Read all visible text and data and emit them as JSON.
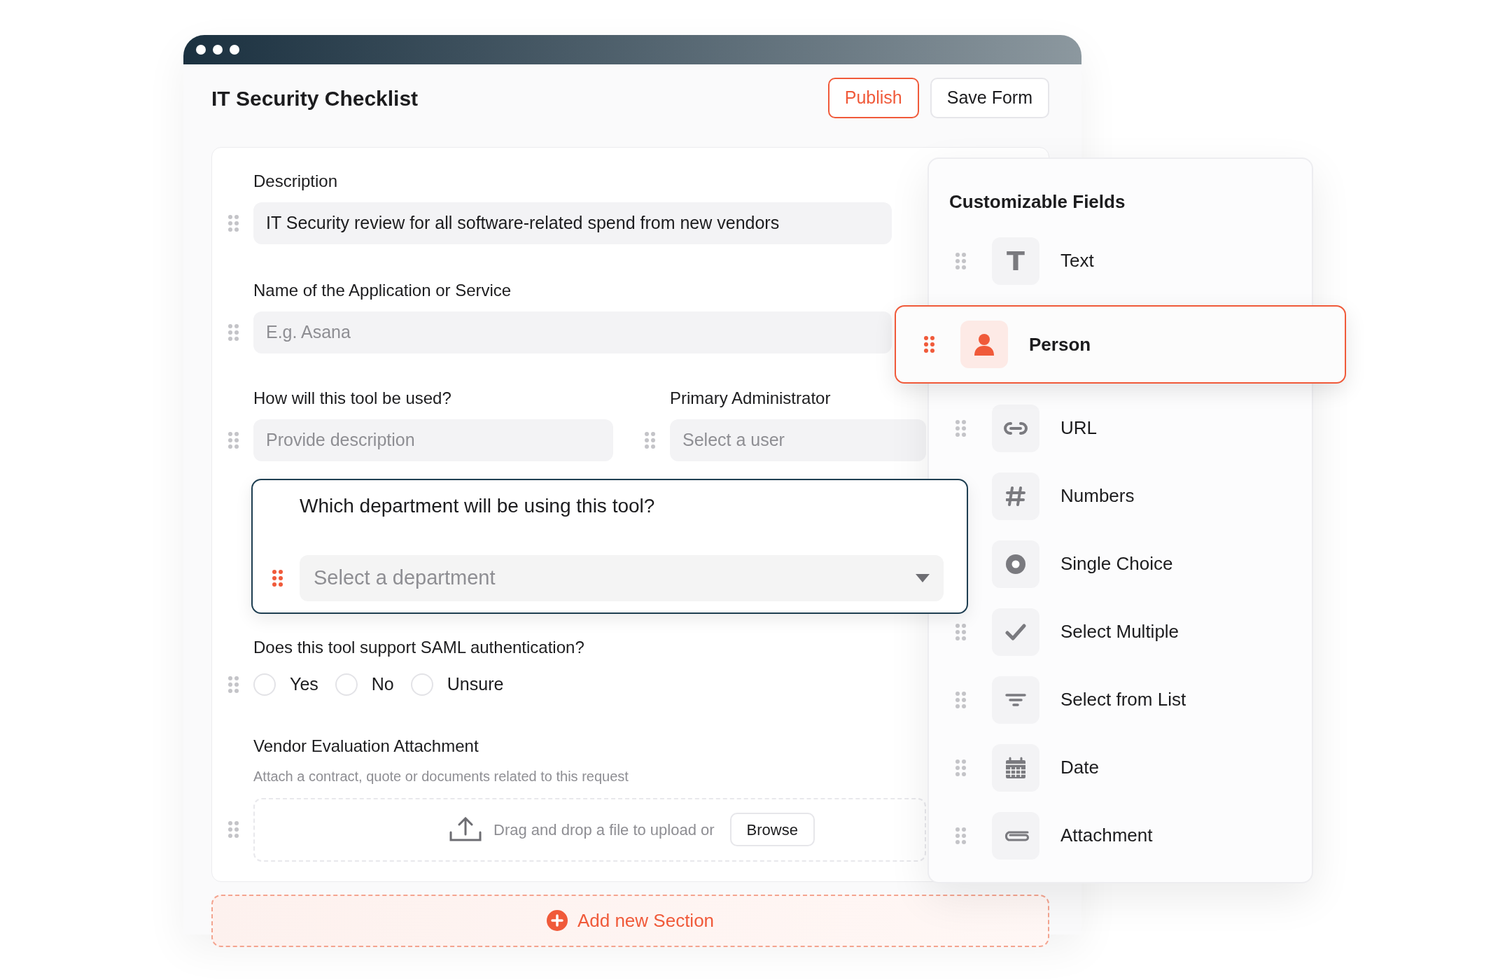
{
  "window": {
    "title": "IT Security Checklist"
  },
  "buttons": [
    {
      "label": "Publish",
      "kind": "primary"
    },
    {
      "label": "Save Form",
      "kind": "secondary"
    }
  ],
  "form": {
    "fields": [
      {
        "kind": "text",
        "label": "Description",
        "value": "IT Security review for all software-related spend from new vendors"
      },
      {
        "kind": "text",
        "label": "Name of the Application or Service",
        "placeholder": "E.g. Asana"
      },
      {
        "kind": "pair",
        "fields": [
          {
            "label": "How will this tool be used?",
            "placeholder": "Provide description"
          },
          {
            "label": "Primary Administrator",
            "placeholder": "Select a user"
          }
        ]
      },
      {
        "kind": "dropdown",
        "label": "Which department will be using this tool?",
        "placeholder": "Select a department",
        "selected": true
      },
      {
        "kind": "radio",
        "label": "Does this tool support SAML authentication?",
        "options": [
          {
            "label": "Yes",
            "selected": false
          },
          {
            "label": "No",
            "selected": false
          },
          {
            "label": "Unsure",
            "selected": false
          }
        ]
      },
      {
        "kind": "attachment",
        "label": "Vendor Evaluation Attachment",
        "hint": "Attach a contract, quote or documents related to this request",
        "prompt": "Drag and drop a file to upload or",
        "button": "Browse"
      }
    ]
  },
  "add_section": "Add new Section",
  "panel": {
    "title": "Customizable Fields",
    "items": [
      {
        "kind": "text",
        "label": "Text",
        "selected": false,
        "handle": true,
        "icon_text": "T"
      },
      {
        "kind": "person",
        "label": "Person",
        "selected": true,
        "handle": true
      },
      {
        "kind": "url",
        "label": "URL",
        "selected": false,
        "handle": true
      },
      {
        "kind": "numbers",
        "label": "Numbers",
        "selected": false,
        "handle": false
      },
      {
        "kind": "single",
        "label": "Single Choice",
        "selected": false,
        "handle": false
      },
      {
        "kind": "multiple",
        "label": "Select Multiple",
        "selected": false,
        "handle": true
      },
      {
        "kind": "list",
        "label": "Select from List",
        "selected": false,
        "handle": true
      },
      {
        "kind": "date",
        "label": "Date",
        "selected": false,
        "handle": true
      },
      {
        "kind": "attachment",
        "label": "Attachment",
        "selected": false,
        "handle": true
      }
    ]
  }
}
